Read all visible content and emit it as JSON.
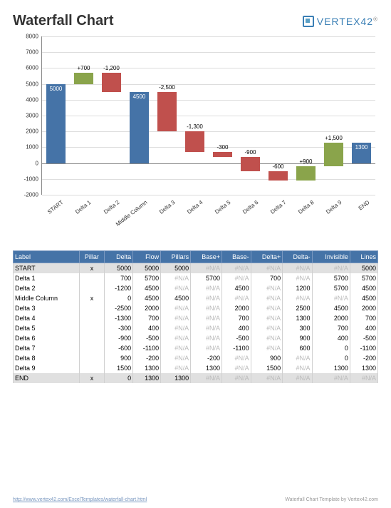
{
  "title": "Waterfall Chart",
  "brand": {
    "name": "VERTEX",
    "suffix": "42",
    "reg": "®"
  },
  "chart_data": {
    "type": "bar",
    "subtype": "waterfall",
    "ylim": [
      -2000,
      8000
    ],
    "yticks": [
      -2000,
      -1000,
      0,
      1000,
      2000,
      3000,
      4000,
      5000,
      6000,
      7000,
      8000
    ],
    "categories": [
      "START",
      "Delta 1",
      "Delta 2",
      "Middle Column",
      "Delta 3",
      "Delta 4",
      "Delta 5",
      "Delta 6",
      "Delta 7",
      "Delta 8",
      "Delta 9",
      "END"
    ],
    "series": [
      {
        "label": "START",
        "kind": "pillar",
        "value": 5000,
        "base": 0,
        "display": "5000"
      },
      {
        "label": "Delta 1",
        "kind": "up",
        "value": 700,
        "base": 5000,
        "display": "+700"
      },
      {
        "label": "Delta 2",
        "kind": "down",
        "value": -1200,
        "base": 5700,
        "display": "-1,200"
      },
      {
        "label": "Middle Column",
        "kind": "pillar",
        "value": 4500,
        "base": 0,
        "display": "4500"
      },
      {
        "label": "Delta 3",
        "kind": "down",
        "value": -2500,
        "base": 4500,
        "display": "-2,500"
      },
      {
        "label": "Delta 4",
        "kind": "down",
        "value": -1300,
        "base": 2000,
        "display": "-1,300"
      },
      {
        "label": "Delta 5",
        "kind": "down",
        "value": -300,
        "base": 700,
        "display": "-300"
      },
      {
        "label": "Delta 6",
        "kind": "down",
        "value": -900,
        "base": 400,
        "display": "-900"
      },
      {
        "label": "Delta 7",
        "kind": "down",
        "value": -600,
        "base": -500,
        "display": "-600"
      },
      {
        "label": "Delta 8",
        "kind": "up",
        "value": 900,
        "base": -1100,
        "display": "+900"
      },
      {
        "label": "Delta 9",
        "kind": "up",
        "value": 1500,
        "base": -200,
        "display": "+1,500"
      },
      {
        "label": "END",
        "kind": "pillar",
        "value": 1300,
        "base": 0,
        "display": "1300"
      }
    ]
  },
  "table": {
    "headers": [
      "Label",
      "Pillar",
      "Delta",
      "Flow",
      "Pillars",
      "Base+",
      "Base-",
      "Delta+",
      "Delta-",
      "Invisible",
      "Lines"
    ],
    "rows": [
      [
        "START",
        "x",
        "5000",
        "5000",
        "5000",
        "#N/A",
        "#N/A",
        "#N/A",
        "#N/A",
        "#N/A",
        "5000"
      ],
      [
        "Delta 1",
        "",
        "700",
        "5700",
        "#N/A",
        "5700",
        "#N/A",
        "700",
        "#N/A",
        "5700",
        "5700"
      ],
      [
        "Delta 2",
        "",
        "-1200",
        "4500",
        "#N/A",
        "#N/A",
        "4500",
        "#N/A",
        "1200",
        "5700",
        "4500"
      ],
      [
        "Middle Column",
        "x",
        "0",
        "4500",
        "4500",
        "#N/A",
        "#N/A",
        "#N/A",
        "#N/A",
        "#N/A",
        "4500"
      ],
      [
        "Delta 3",
        "",
        "-2500",
        "2000",
        "#N/A",
        "#N/A",
        "2000",
        "#N/A",
        "2500",
        "4500",
        "2000"
      ],
      [
        "Delta 4",
        "",
        "-1300",
        "700",
        "#N/A",
        "#N/A",
        "700",
        "#N/A",
        "1300",
        "2000",
        "700"
      ],
      [
        "Delta 5",
        "",
        "-300",
        "400",
        "#N/A",
        "#N/A",
        "400",
        "#N/A",
        "300",
        "700",
        "400"
      ],
      [
        "Delta 6",
        "",
        "-900",
        "-500",
        "#N/A",
        "#N/A",
        "-500",
        "#N/A",
        "900",
        "400",
        "-500"
      ],
      [
        "Delta 7",
        "",
        "-600",
        "-1100",
        "#N/A",
        "#N/A",
        "-1100",
        "#N/A",
        "600",
        "0",
        "-1100"
      ],
      [
        "Delta 8",
        "",
        "900",
        "-200",
        "#N/A",
        "-200",
        "#N/A",
        "900",
        "#N/A",
        "0",
        "-200"
      ],
      [
        "Delta 9",
        "",
        "1500",
        "1300",
        "#N/A",
        "1300",
        "#N/A",
        "1500",
        "#N/A",
        "1300",
        "1300"
      ],
      [
        "END",
        "x",
        "0",
        "1300",
        "1300",
        "#N/A",
        "#N/A",
        "#N/A",
        "#N/A",
        "#N/A",
        "#N/A"
      ]
    ]
  },
  "footer": {
    "url": "http://www.vertex42.com/ExcelTemplates/waterfall-chart.html",
    "credit": "Waterfall Chart Template by Vertex42.com"
  }
}
